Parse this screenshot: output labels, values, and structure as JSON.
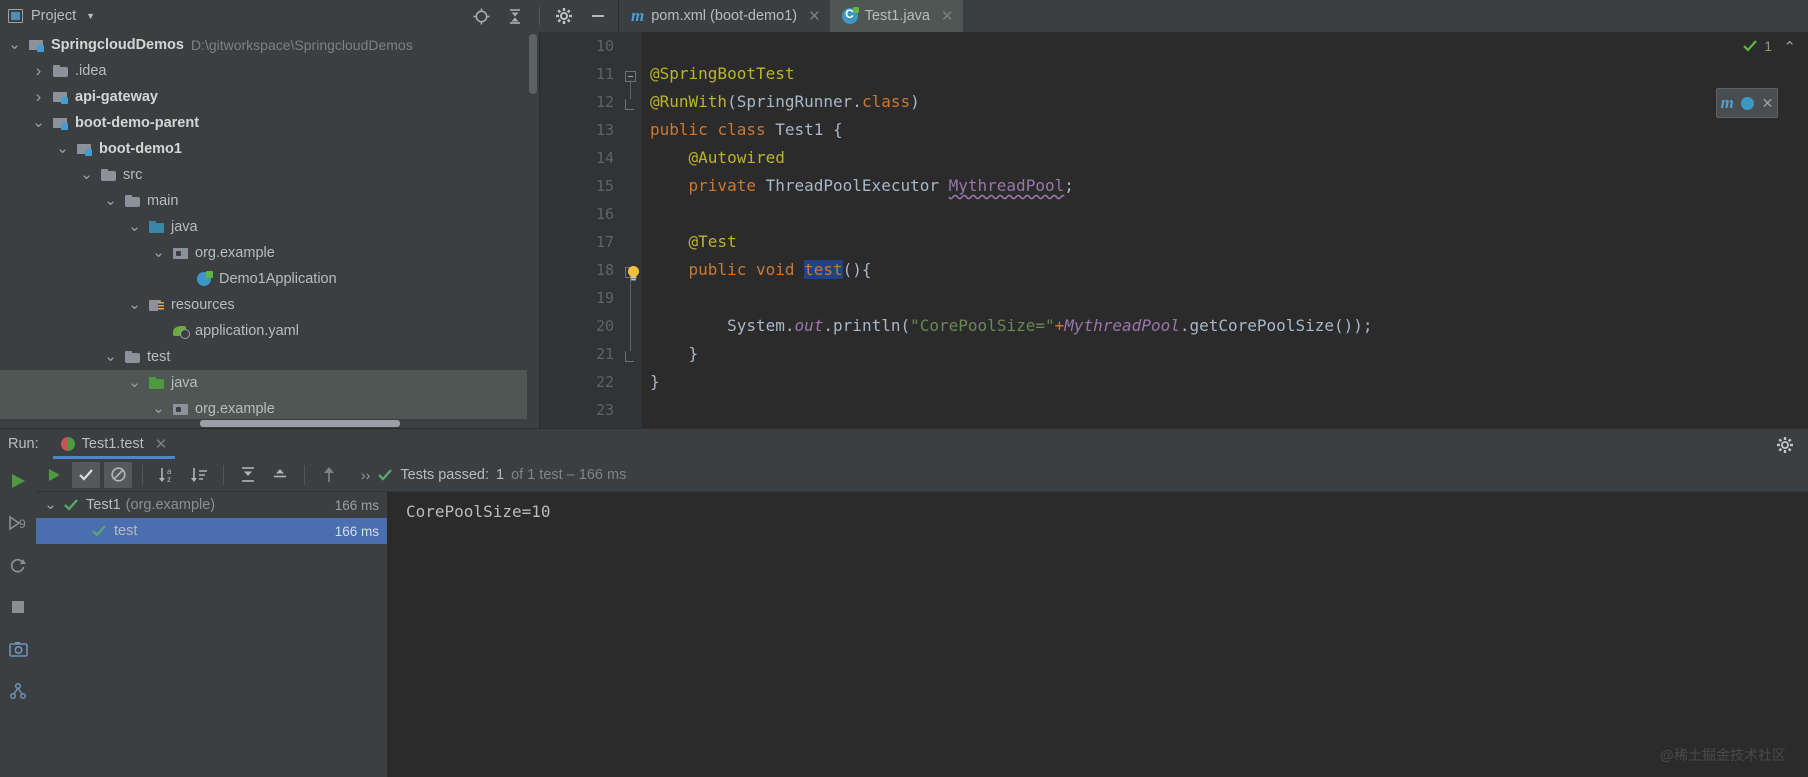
{
  "project_panel": {
    "title": "Project",
    "caret_icon": "chevron-down-icon",
    "window_icon": "project-window-icon",
    "actions": [
      {
        "name": "locate-icon",
        "glyph": "⊕"
      },
      {
        "name": "collapse-all-icon",
        "glyph": "⇮"
      },
      {
        "name": "gear-icon",
        "glyph": "✺"
      },
      {
        "name": "minimize-icon",
        "glyph": "—"
      }
    ],
    "tree": [
      {
        "label": "SpringcloudDemos",
        "path": "D:\\gitworkspace\\SpringcloudDemos",
        "indent": 0,
        "arrow": "v",
        "icon": "module-folder-icon",
        "bold": true,
        "selected": false
      },
      {
        "label": ".idea",
        "path": "",
        "indent": 1,
        "arrow": ">",
        "icon": "folder-icon",
        "bold": false,
        "selected": false
      },
      {
        "label": "api-gateway",
        "path": "",
        "indent": 1,
        "arrow": ">",
        "icon": "module-folder-icon",
        "bold": true,
        "selected": false
      },
      {
        "label": "boot-demo-parent",
        "path": "",
        "indent": 1,
        "arrow": "v",
        "icon": "module-folder-icon",
        "bold": true,
        "selected": false
      },
      {
        "label": "boot-demo1",
        "path": "",
        "indent": 2,
        "arrow": "v",
        "icon": "module-folder-icon",
        "bold": true,
        "selected": false
      },
      {
        "label": "src",
        "path": "",
        "indent": 3,
        "arrow": "v",
        "icon": "folder-icon",
        "bold": false,
        "selected": false
      },
      {
        "label": "main",
        "path": "",
        "indent": 4,
        "arrow": "v",
        "icon": "folder-icon",
        "bold": false,
        "selected": false
      },
      {
        "label": "java",
        "path": "",
        "indent": 5,
        "arrow": "v",
        "icon": "source-root-java-icon",
        "bold": false,
        "selected": false
      },
      {
        "label": "org.example",
        "path": "",
        "indent": 6,
        "arrow": "v",
        "icon": "package-icon",
        "bold": false,
        "selected": false
      },
      {
        "label": "Demo1Application",
        "path": "",
        "indent": 7,
        "arrow": "",
        "icon": "spring-class-icon",
        "bold": false,
        "selected": false
      },
      {
        "label": "resources",
        "path": "",
        "indent": 5,
        "arrow": "v",
        "icon": "resources-folder-icon",
        "bold": false,
        "selected": false
      },
      {
        "label": "application.yaml",
        "path": "",
        "indent": 6,
        "arrow": "",
        "icon": "spring-yaml-icon",
        "bold": false,
        "selected": false
      },
      {
        "label": "test",
        "path": "",
        "indent": 4,
        "arrow": "v",
        "icon": "folder-icon",
        "bold": false,
        "selected": false
      },
      {
        "label": "java",
        "path": "",
        "indent": 5,
        "arrow": "v",
        "icon": "test-root-java-icon",
        "bold": false,
        "selected": true
      },
      {
        "label": "org.example",
        "path": "",
        "indent": 6,
        "arrow": "v",
        "icon": "package-icon",
        "bold": false,
        "selected": true
      }
    ]
  },
  "editor": {
    "tabs": [
      {
        "label": "pom.xml (boot-demo1)",
        "icon": "maven-m-icon",
        "active": false,
        "close_glyph": "✕"
      },
      {
        "label": "Test1.java",
        "icon": "java-class-icon",
        "active": true,
        "close_glyph": "✕"
      }
    ],
    "status_count": "1",
    "status_icon": "check-green-icon",
    "collapse_glyph": "⌃",
    "inspect_widget": {
      "maven_icon": "maven-m-icon",
      "sync_icon": "maven-sync-icon",
      "close_glyph": "✕"
    },
    "lines": [
      {
        "num": "10",
        "gutter_icon": "",
        "fold": "",
        "tokens": []
      },
      {
        "num": "11",
        "gutter_icon": "spring-leaf-icon",
        "fold": "minus",
        "tokens": [
          {
            "t": "@SpringBootTest",
            "c": "ann"
          }
        ]
      },
      {
        "num": "12",
        "gutter_icon": "",
        "fold": "end",
        "tokens": [
          {
            "t": "@RunWith",
            "c": "ann"
          },
          {
            "t": "(",
            "c": "plain"
          },
          {
            "t": "SpringRunner",
            "c": "cls"
          },
          {
            "t": ".",
            "c": "plain"
          },
          {
            "t": "class",
            "c": "kw"
          },
          {
            "t": ")",
            "c": "plain"
          }
        ]
      },
      {
        "num": "13",
        "gutter_icon": "run-test-icon",
        "fold": "",
        "tokens": [
          {
            "t": "public ",
            "c": "kw"
          },
          {
            "t": "class ",
            "c": "kw"
          },
          {
            "t": "Test1 {",
            "c": "cls"
          }
        ]
      },
      {
        "num": "14",
        "gutter_icon": "",
        "fold": "",
        "tokens": [
          {
            "t": "    @Autowired",
            "c": "ann"
          }
        ]
      },
      {
        "num": "15",
        "gutter_icon": "bean-icon",
        "fold": "",
        "tokens": [
          {
            "t": "    ",
            "c": "plain"
          },
          {
            "t": "private ",
            "c": "kw"
          },
          {
            "t": "ThreadPoolExecutor ",
            "c": "cls"
          },
          {
            "t": "MythreadPool",
            "c": "var-u"
          },
          {
            "t": ";",
            "c": "plain"
          }
        ]
      },
      {
        "num": "16",
        "gutter_icon": "",
        "fold": "",
        "tokens": []
      },
      {
        "num": "17",
        "gutter_icon": "",
        "fold": "",
        "tokens": [
          {
            "t": "    @Test",
            "c": "ann"
          }
        ]
      },
      {
        "num": "18",
        "gutter_icon": "run-test-icon",
        "fold": "minus",
        "tokens": [
          {
            "t": "    ",
            "c": "plain"
          },
          {
            "t": "public void ",
            "c": "kw"
          },
          {
            "t": "test",
            "c": "sel"
          },
          {
            "t": "(){",
            "c": "plain"
          }
        ],
        "bulb": true
      },
      {
        "num": "19",
        "gutter_icon": "",
        "fold": "",
        "tokens": []
      },
      {
        "num": "20",
        "gutter_icon": "",
        "fold": "",
        "tokens": [
          {
            "t": "        System",
            "c": "plain"
          },
          {
            "t": ".",
            "c": "plain"
          },
          {
            "t": "out",
            "c": "field"
          },
          {
            "t": ".println(",
            "c": "plain"
          },
          {
            "t": "\"CorePoolSize=\"",
            "c": "str"
          },
          {
            "t": "+",
            "c": "kw"
          },
          {
            "t": "MythreadPool",
            "c": "field"
          },
          {
            "t": ".getCorePoolSize());",
            "c": "plain"
          }
        ]
      },
      {
        "num": "21",
        "gutter_icon": "",
        "fold": "end",
        "tokens": [
          {
            "t": "    }",
            "c": "plain"
          }
        ]
      },
      {
        "num": "22",
        "gutter_icon": "",
        "fold": "",
        "tokens": [
          {
            "t": "}",
            "c": "plain"
          }
        ]
      },
      {
        "num": "23",
        "gutter_icon": "",
        "fold": "",
        "tokens": []
      }
    ]
  },
  "run_panel": {
    "run_label": "Run:",
    "tab_label": "Test1.test",
    "tab_icon": "junit-icon",
    "tab_close_glyph": "✕",
    "settings_icon": "gear-icon",
    "left_strip": [
      {
        "name": "run-icon",
        "glyph": "▶"
      },
      {
        "name": "debug-icon",
        "glyph": "🐞"
      },
      {
        "name": "rerun-icon",
        "glyph": "↻"
      },
      {
        "name": "stop-icon",
        "glyph": "■"
      },
      {
        "name": "screenshot-icon",
        "glyph": "📷"
      },
      {
        "name": "structure-icon",
        "glyph": "⚙"
      }
    ],
    "toolbar": [
      {
        "name": "run-test-button",
        "glyph": "▶",
        "active": false
      },
      {
        "name": "show-passed-toggle",
        "glyph": "✔",
        "active": true
      },
      {
        "name": "show-ignored-toggle",
        "glyph": "⊘",
        "active": true
      },
      {
        "name": "sort-alphabetically-button",
        "glyph": "↓a",
        "active": false
      },
      {
        "name": "sort-by-duration-button",
        "glyph": "↓≡",
        "active": false
      },
      {
        "name": "expand-all-button",
        "glyph": "⤒",
        "active": false
      },
      {
        "name": "collapse-all-button",
        "glyph": "⤓",
        "active": false
      },
      {
        "name": "previous-failed-button",
        "glyph": "↑",
        "active": false
      }
    ],
    "status": {
      "chevrons": "››",
      "check_icon": "check-green-icon",
      "label": "Tests passed:",
      "count": "1",
      "suffix": "of 1 test – 166 ms"
    },
    "test_tree": [
      {
        "label": "Test1",
        "package": "(org.example)",
        "time": "166 ms",
        "arrow": "v",
        "indent": 0,
        "selected": false,
        "status_icon": "check-green-icon"
      },
      {
        "label": "test",
        "package": "",
        "time": "166 ms",
        "arrow": "",
        "indent": 1,
        "selected": true,
        "status_icon": "check-green-icon"
      }
    ],
    "console_lines": [
      "CorePoolSize=10"
    ],
    "watermark": "@稀土掘金技术社区"
  },
  "colors": {
    "accent_blue": "#4b6eaf",
    "selection_green": "#4e5754",
    "success_green": "#59a869",
    "editor_bg": "#2b2b2b",
    "panel_bg": "#3c3f41"
  }
}
